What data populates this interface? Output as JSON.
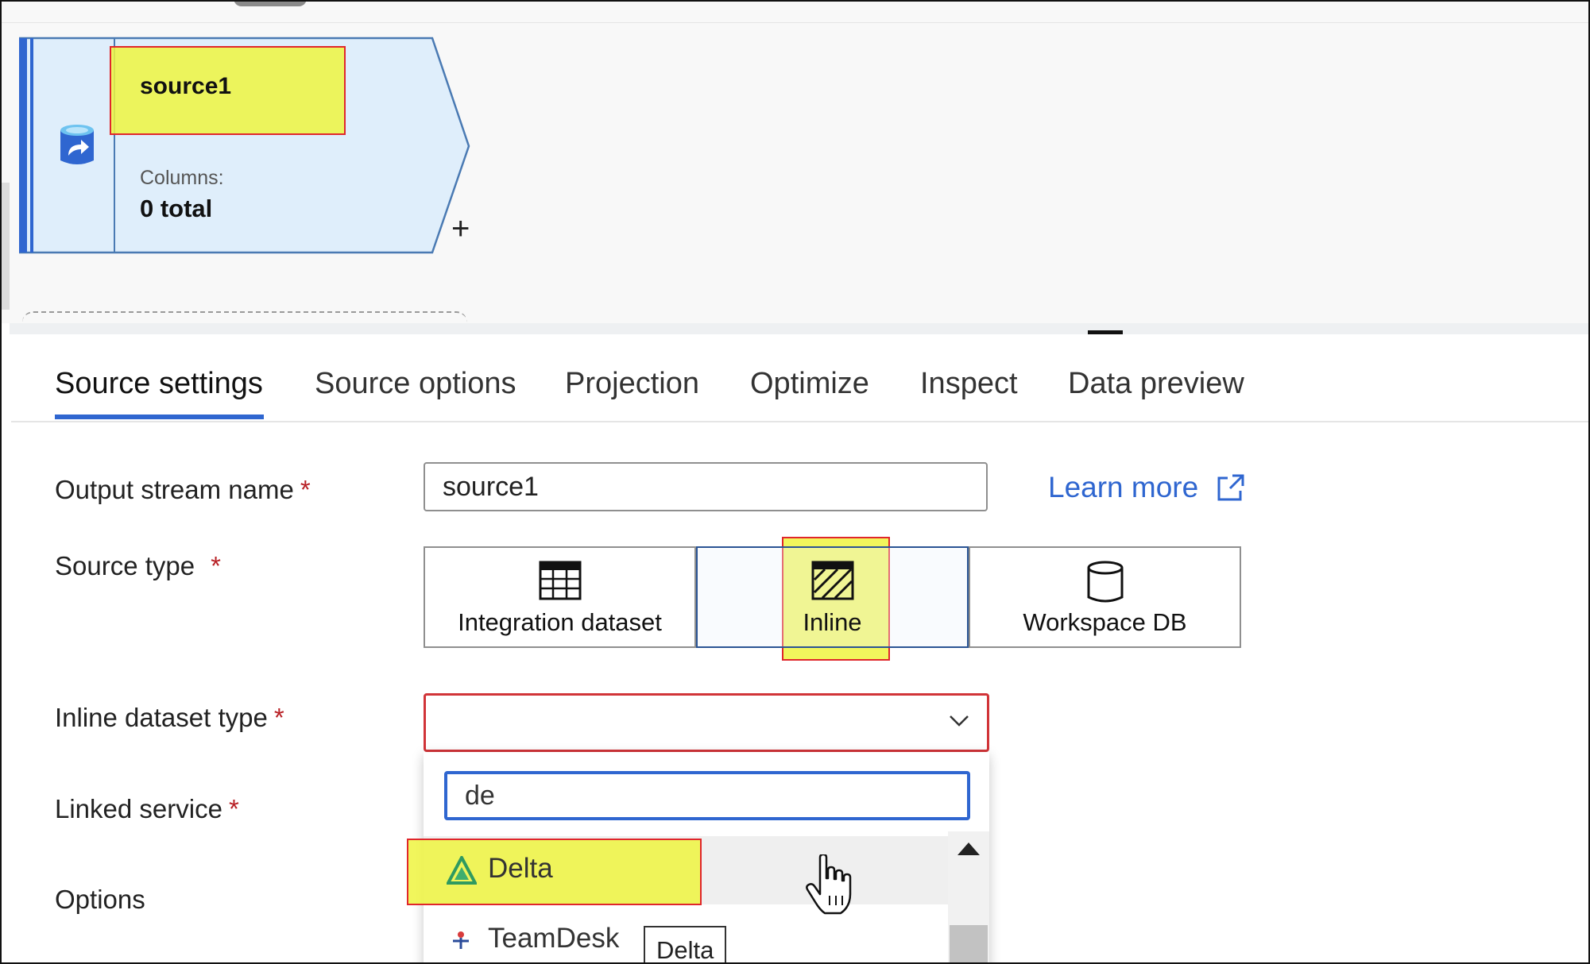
{
  "canvas": {
    "node": {
      "title": "source1",
      "columns_label": "Columns:",
      "columns_value": "0 total",
      "icon": "database-export-icon"
    },
    "add_icon": "plus-icon"
  },
  "tabs": [
    {
      "label": "Source settings",
      "active": true
    },
    {
      "label": "Source options",
      "active": false
    },
    {
      "label": "Projection",
      "active": false
    },
    {
      "label": "Optimize",
      "active": false
    },
    {
      "label": "Inspect",
      "active": false
    },
    {
      "label": "Data preview",
      "active": false
    }
  ],
  "form": {
    "output_stream": {
      "label": "Output stream name",
      "required": "*",
      "value": "source1"
    },
    "learn_more": {
      "label": "Learn more",
      "icon": "external-link-icon"
    },
    "source_type": {
      "label": "Source type",
      "required": "*",
      "options": [
        {
          "label": "Integration dataset",
          "icon": "table-grid-icon",
          "selected": false
        },
        {
          "label": "Inline",
          "icon": "hatched-table-icon",
          "selected": true
        },
        {
          "label": "Workspace DB",
          "icon": "cylinder-icon",
          "selected": false
        }
      ]
    },
    "inline_dataset_type": {
      "label": "Inline dataset type",
      "required": "*",
      "value": "",
      "search_value": "de",
      "options": [
        {
          "label": "Delta",
          "icon": "delta-logo-icon",
          "hover": true
        },
        {
          "label": "TeamDesk",
          "icon": "teamdesk-logo-icon",
          "hover": false
        }
      ],
      "tooltip": "Delta"
    },
    "linked_service": {
      "label": "Linked service",
      "required": "*"
    },
    "options_label": "Options"
  },
  "colors": {
    "accent": "#2f66d0",
    "error": "#d13438",
    "highlight": "#eff540",
    "node_fill": "#dfeefb"
  }
}
